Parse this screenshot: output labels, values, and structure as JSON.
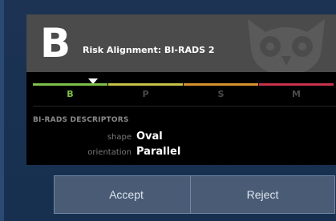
{
  "card": {
    "grade_letter": "B",
    "title": "Risk Alignment: BI-RADS 2"
  },
  "scale": {
    "items": [
      {
        "label": "B",
        "color": "#7ec04a",
        "active": true
      },
      {
        "label": "P",
        "color": "#c6c24a",
        "active": false
      },
      {
        "label": "S",
        "color": "#d8922e",
        "active": false
      },
      {
        "label": "M",
        "color": "#c8324a",
        "active": false
      }
    ],
    "marker_on": "B"
  },
  "descriptors": {
    "section_title": "BI-RADS DESCRIPTORS",
    "rows": [
      {
        "key": "shape",
        "value": "Oval"
      },
      {
        "key": "orientation",
        "value": "Parallel"
      }
    ]
  },
  "buttons": {
    "accept_label": "Accept",
    "reject_label": "Reject"
  },
  "icons": {
    "watermark": "owl-logo-icon",
    "marker": "triangle-down-icon"
  }
}
